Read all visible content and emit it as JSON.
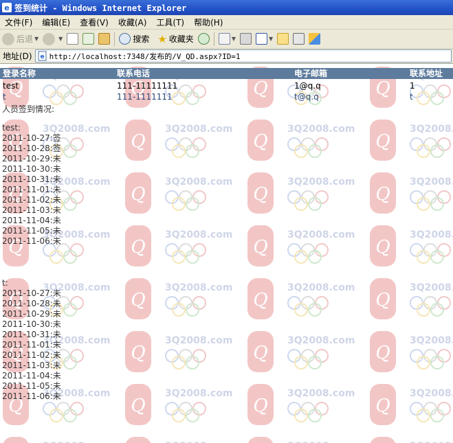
{
  "window": {
    "title": "签到统计 - Windows Internet Explorer"
  },
  "menu": [
    "文件(F)",
    "编辑(E)",
    "查看(V)",
    "收藏(A)",
    "工具(T)",
    "帮助(H)"
  ],
  "toolbar": {
    "back": "后退",
    "search": "搜索",
    "favorites": "收藏夹"
  },
  "address": {
    "label": "地址(D)",
    "url": "http://localhost:7348/发布的/V_QD.aspx?ID=1"
  },
  "table": {
    "headers": [
      "登录名称",
      "联系电话",
      "电子邮箱",
      "联系地址"
    ],
    "rows": [
      [
        "test",
        "111-11111111",
        "1@q.q",
        "1"
      ],
      [
        "t",
        "111-1111111",
        "t@q.q",
        "t"
      ]
    ]
  },
  "signin": {
    "heading": "人员签到情况:",
    "people": [
      {
        "name": "test:",
        "records": [
          "2011-10-27:签",
          "2011-10-28:签",
          "2011-10-29:未",
          "2011-10-30:未",
          "2011-10-31:未",
          "2011-11-01:未",
          "2011-11-02:未",
          "2011-11-03:未",
          "2011-11-04:未",
          "2011-11-05:未",
          "2011-11-06:未"
        ]
      },
      {
        "name": "t:",
        "records": [
          "2011-10-27:未",
          "2011-10-28:未",
          "2011-10-29:未",
          "2011-10-30:未",
          "2011-10-31:未",
          "2011-11-01:未",
          "2011-11-02:未",
          "2011-11-03:未",
          "2011-11-04:未",
          "2011-11-05:未",
          "2011-11-06:未"
        ]
      }
    ]
  },
  "colors": {
    "header_bg": "#5d7b9d",
    "alt_row_text": "#284775",
    "titlebar": "#2352c8"
  },
  "watermark": {
    "text": "3Q2008.com"
  }
}
